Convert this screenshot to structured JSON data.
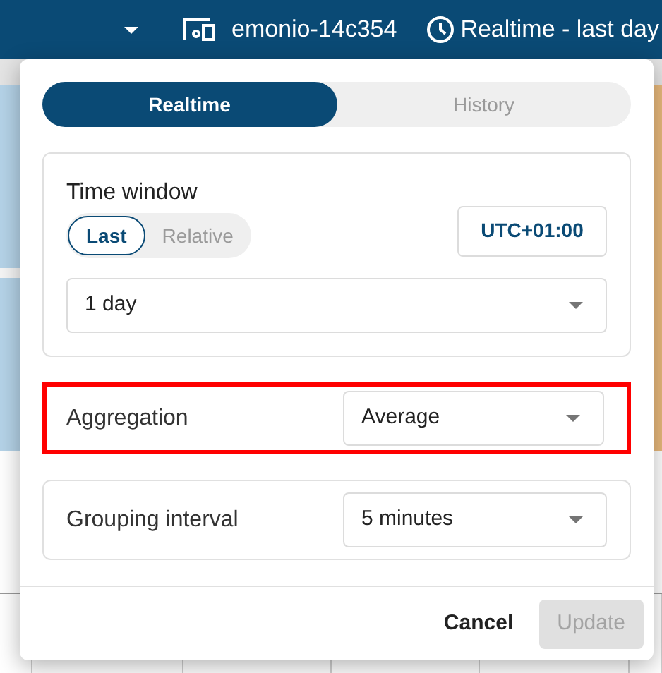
{
  "app_bar": {
    "device": "emonio-14c354",
    "time_range": "Realtime - last day"
  },
  "dialog": {
    "tabs": [
      {
        "label": "Realtime",
        "selected": true
      },
      {
        "label": "History",
        "selected": false
      }
    ],
    "time_window": {
      "title": "Time window",
      "modes": [
        {
          "label": "Last",
          "selected": true
        },
        {
          "label": "Relative",
          "selected": false
        }
      ],
      "timezone": "UTC+01:00",
      "duration": "1 day"
    },
    "aggregation": {
      "label": "Aggregation",
      "value": "Average",
      "highlighted": true
    },
    "grouping": {
      "label": "Grouping interval",
      "value": "5 minutes",
      "highlighted": false
    },
    "buttons": [
      {
        "label": "Cancel",
        "disabled": false
      },
      {
        "label": "Update",
        "disabled": true
      }
    ]
  }
}
